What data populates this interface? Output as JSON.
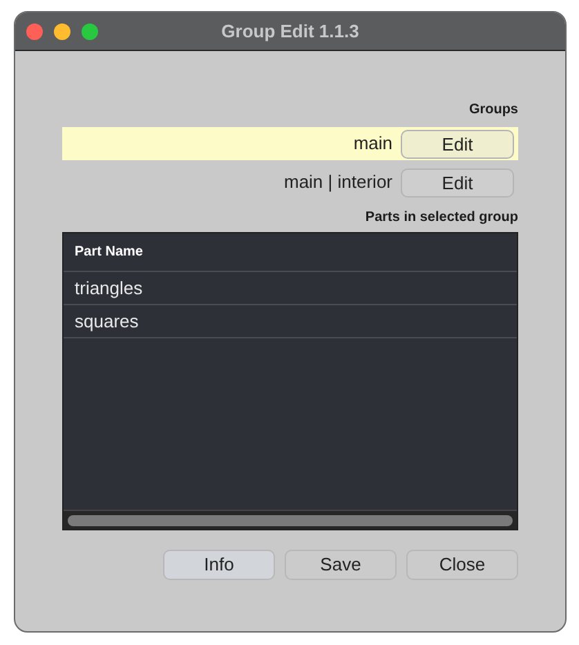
{
  "window": {
    "title": "Group Edit 1.1.3"
  },
  "groups": {
    "label": "Groups",
    "items": [
      {
        "name": "main",
        "button": "Edit",
        "selected": true
      },
      {
        "name": "main | interior",
        "button": "Edit",
        "selected": false
      }
    ]
  },
  "parts": {
    "label": "Parts in selected group",
    "columns": [
      "Part Name"
    ],
    "rows": [
      {
        "name": "triangles"
      },
      {
        "name": "squares"
      }
    ]
  },
  "buttons": [
    {
      "label": "Info",
      "focused": true
    },
    {
      "label": "Save",
      "focused": false
    },
    {
      "label": "Close",
      "focused": false
    }
  ]
}
